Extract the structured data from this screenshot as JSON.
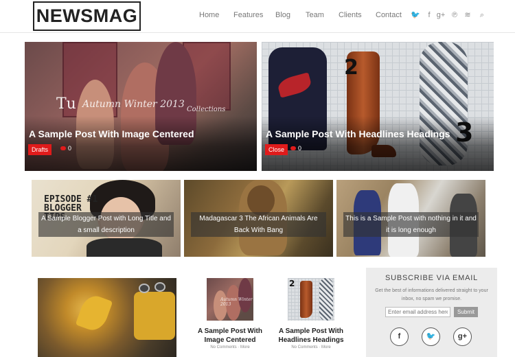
{
  "header": {
    "logo": "NEWSMAG",
    "nav": [
      "Home",
      "Features",
      "Blog",
      "Team",
      "Clients",
      "Contact"
    ],
    "social_icons": [
      "twitter-icon",
      "facebook-icon",
      "google-plus-icon",
      "pinterest-icon",
      "rss-icon",
      "search-icon"
    ],
    "social_glyphs": [
      "🐦",
      "f",
      "g+",
      "℗",
      "≋",
      "⌕"
    ]
  },
  "featured": [
    {
      "title": "A Sample Post With Image Centered",
      "category": "Drafts",
      "comments": "0",
      "image_text": "Autumn Winter 2013",
      "image_text_2": "Collections",
      "image_logo": "Tu"
    },
    {
      "title": "A Sample Post With Headlines Headings",
      "category": "Close",
      "comments": "0",
      "image_num_1": "2",
      "image_num_2": "3"
    }
  ],
  "tiles": [
    {
      "caption": "A Sample Blogger Post with Long Title and a small description",
      "image_text": "EPISODE #1 BLOGGER TIPS"
    },
    {
      "caption": "Madagascar 3 The African Animals Are Back With Bang"
    },
    {
      "caption": "This is a Sample Post with nothing in it and it is long enough"
    }
  ],
  "posts": [
    {
      "title": "A Sample Post With Image Centered",
      "meta": "No Comments · More"
    },
    {
      "title": "A Sample Post With Headlines Headings",
      "meta": "No Comments · More"
    }
  ],
  "subscribe": {
    "title": "SUBSCRIBE VIA EMAIL",
    "description": "Get the best of informations delivered straight to your inbox, no spam we promise.",
    "placeholder": "Enter email address here",
    "button": "Submit",
    "icons": [
      "facebook-icon",
      "twitter-icon",
      "google-plus-icon"
    ],
    "glyphs": [
      "f",
      "🐦",
      "g+"
    ]
  }
}
